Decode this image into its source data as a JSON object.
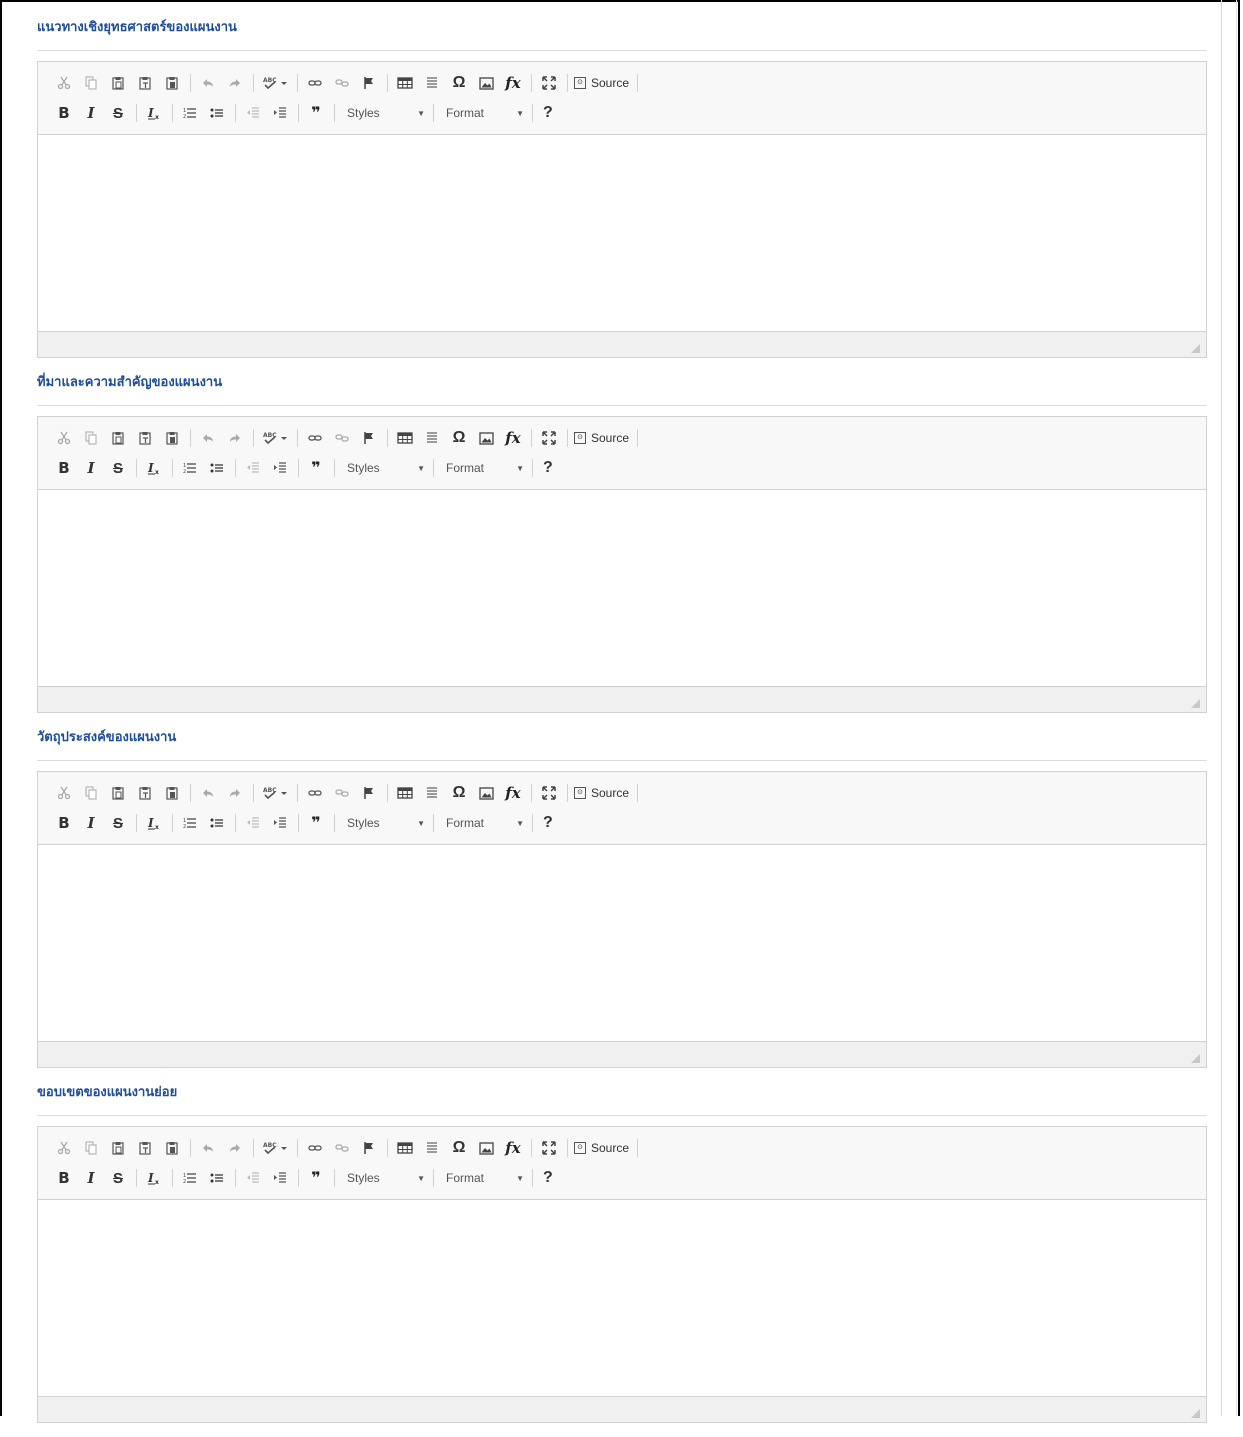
{
  "sections": [
    {
      "title": "แนวทางเชิงยุทธศาสตร์ของแผนงาน"
    },
    {
      "title": "ที่มาและความสำคัญของแผนงาน"
    },
    {
      "title": "วัตถุประสงค์ของแผนงาน"
    },
    {
      "title": "ขอบเขตของแผนงานย่อย"
    }
  ],
  "toolbar": {
    "source_label": "Source",
    "styles_label": "Styles",
    "format_label": "Format",
    "help_label": "?",
    "bold_label": "B",
    "italic_label": "I",
    "strike_label": "S",
    "quote_label": "❞",
    "icons_row1": [
      "cut-icon",
      "copy-icon",
      "paste-icon",
      "paste-text-icon",
      "paste-word-icon",
      "undo-icon",
      "redo-icon",
      "spellcheck-icon",
      "link-icon",
      "unlink-icon",
      "anchor-icon",
      "table-icon",
      "horizontal-rule-icon",
      "special-char-icon",
      "image-icon",
      "formula-icon",
      "maximize-icon",
      "source-icon"
    ],
    "icons_row2": [
      "bold-icon",
      "italic-icon",
      "strike-icon",
      "remove-format-icon",
      "numbered-list-icon",
      "bulleted-list-icon",
      "outdent-icon",
      "indent-icon",
      "blockquote-icon",
      "help-icon"
    ]
  },
  "colors": {
    "title": "#1f4e9c",
    "toolbar_bg": "#f8f8f8",
    "border": "#d1d1d1"
  }
}
